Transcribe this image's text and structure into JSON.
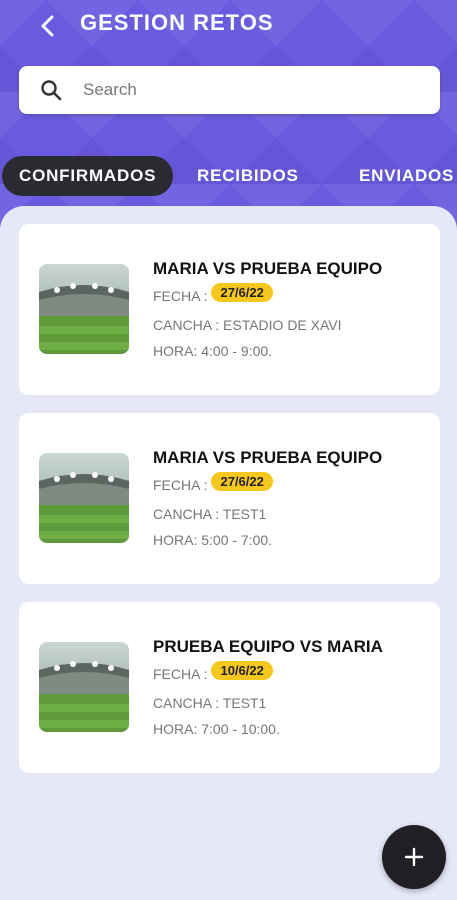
{
  "header": {
    "title": "GESTION RETOS",
    "back_icon": "chevron-left-icon"
  },
  "search": {
    "placeholder": "Search",
    "value": ""
  },
  "tabs": [
    {
      "label": "CONFIRMADOS",
      "active": true
    },
    {
      "label": "RECIBIDOS",
      "active": false
    },
    {
      "label": "ENVIADOS",
      "active": false
    }
  ],
  "cards": [
    {
      "match": "MARIA VS PRUEBA EQUIPO",
      "fecha_label": "FECHA :",
      "date": "27/6/22",
      "cancha": "CANCHA : ESTADIO DE XAVI",
      "hora": "HORA: 4:00 - 9:00."
    },
    {
      "match": "MARIA VS PRUEBA EQUIPO",
      "fecha_label": "FECHA :",
      "date": "27/6/22",
      "cancha": "CANCHA : TEST1",
      "hora": "HORA: 5:00 - 7:00."
    },
    {
      "match": "PRUEBA EQUIPO VS MARIA",
      "fecha_label": "FECHA :",
      "date": "10/6/22",
      "cancha": "CANCHA : TEST1",
      "hora": "HORA: 7:00 - 10:00."
    }
  ],
  "fab": {
    "icon": "plus-icon"
  },
  "colors": {
    "header": "#6a5ae0",
    "active_tab": "#2a2a30",
    "date_badge": "#f6c81c",
    "fab": "#1f1f24"
  }
}
